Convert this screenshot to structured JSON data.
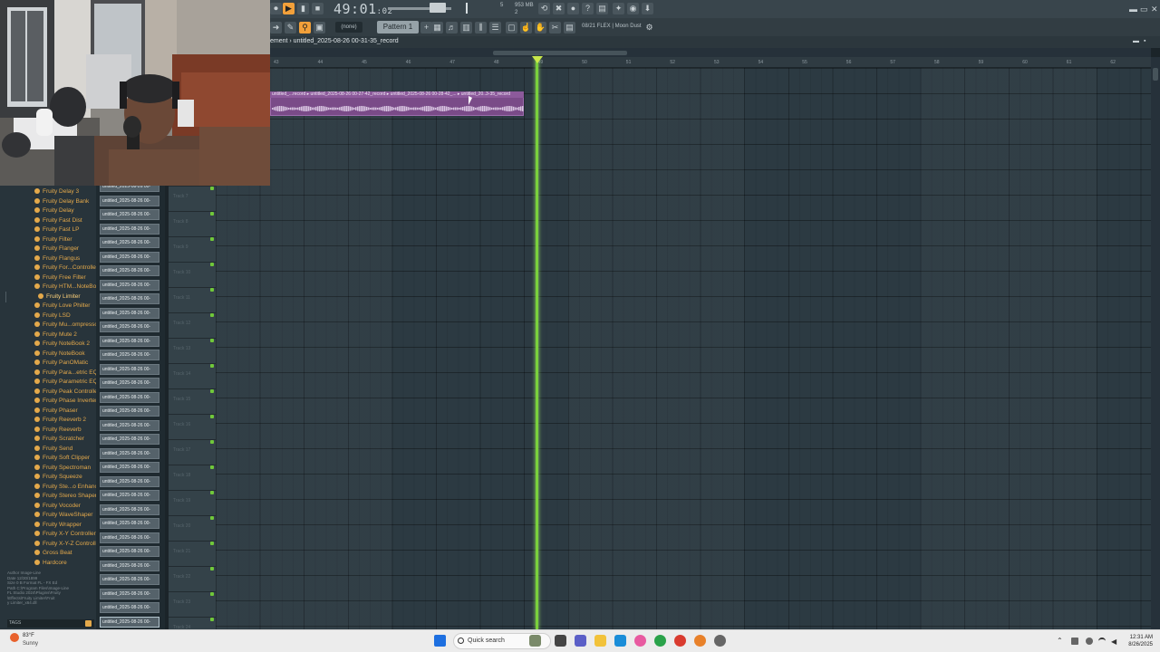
{
  "toolbar": {
    "time": "49:01",
    "time_sub": "02",
    "memory": "953 MB",
    "cpu": "5",
    "voices": "2",
    "pattern_select": "(none)",
    "pattern": "Pattern 1",
    "hint": "08/21  FLEX | Moon Dust"
  },
  "playlist": {
    "title": "ement › untitled_2025-08-26 00-31-35_record",
    "ruler_ticks": [
      "43",
      "44",
      "45",
      "46",
      "47",
      "48",
      "49",
      "50",
      "51",
      "52",
      "53",
      "54",
      "55",
      "56",
      "57",
      "58",
      "59",
      "60",
      "61",
      "62"
    ],
    "clip_label": "untitled_...record ▸ untitled_2025-08-26 00-27-42_record ▸ untitled_2025-08-26 00-28-42_... ▸ untitled_20..3-35_record"
  },
  "browser": {
    "items": [
      "Fruity Delay 3",
      "Fruity Delay Bank",
      "Fruity Delay",
      "Fruity Fast Dist",
      "Fruity Fast LP",
      "Fruity Filter",
      "Fruity Flanger",
      "Fruity Flangus",
      "Fruity For...Controller",
      "Fruity Free Filter",
      "Fruity HTM...NoteBook",
      "Fruity Limiter",
      "Fruity Love Philter",
      "Fruity LSD",
      "Fruity Mu...ompressor",
      "Fruity Mute 2",
      "Fruity NoteBook 2",
      "Fruity NoteBook",
      "Fruity PanOMatic",
      "Fruity Para...etric EQ 2",
      "Fruity Parametric EQ",
      "Fruity Peak Controller",
      "Fruity Phase Inverter",
      "Fruity Phaser",
      "Fruity Reeverb 2",
      "Fruity Reeverb",
      "Fruity Scratcher",
      "Fruity Send",
      "Fruity Soft Clipper",
      "Fruity Spectroman",
      "Fruity Squeeze",
      "Fruity Ste...o Enhancer",
      "Fruity Stereo Shaper",
      "Fruity Vocoder",
      "Fruity WaveShaper",
      "Fruity Wrapper",
      "Fruity X-Y Controller",
      "Fruity X-Y-Z Controller",
      "Gross Beat",
      "Hardcore"
    ],
    "selected": "Fruity Limiter",
    "info_lines": [
      "Author  Image-Line",
      "Date  12/30/1899",
      "Size  0 B         Format  FL - FX Ed",
      "Path  C:\\Program Files\\Image-Line",
      "FL Studio 2024\\Plugins\\Fruity",
      "\\Effects\\Fruity Limiter\\Fruit",
      "y Limiter_x64.dll"
    ],
    "tags_label": "TAGS"
  },
  "clips": {
    "label": "untitled_2025-08-26 00-",
    "count": 32
  },
  "tracks": {
    "names": [
      "Track 7",
      "Track 8",
      "Track 9",
      "Track 10",
      "Track 11",
      "Track 12",
      "Track 13",
      "Track 14",
      "Track 15",
      "Track 16",
      "Track 17",
      "Track 18",
      "Track 19",
      "Track 20",
      "Track 21",
      "Track 22",
      "Track 23",
      "Track 24"
    ]
  },
  "taskbar": {
    "weather_temp": "83°F",
    "weather_desc": "Sunny",
    "search_placeholder": "Quick search",
    "clock_time": "12:31 AM",
    "clock_date": "8/26/2025"
  },
  "colors": {
    "accent_orange": "#f2a03a",
    "playhead": "#7ad03c",
    "clip": "#7a4b88",
    "browser_text": "#e4a94b"
  }
}
